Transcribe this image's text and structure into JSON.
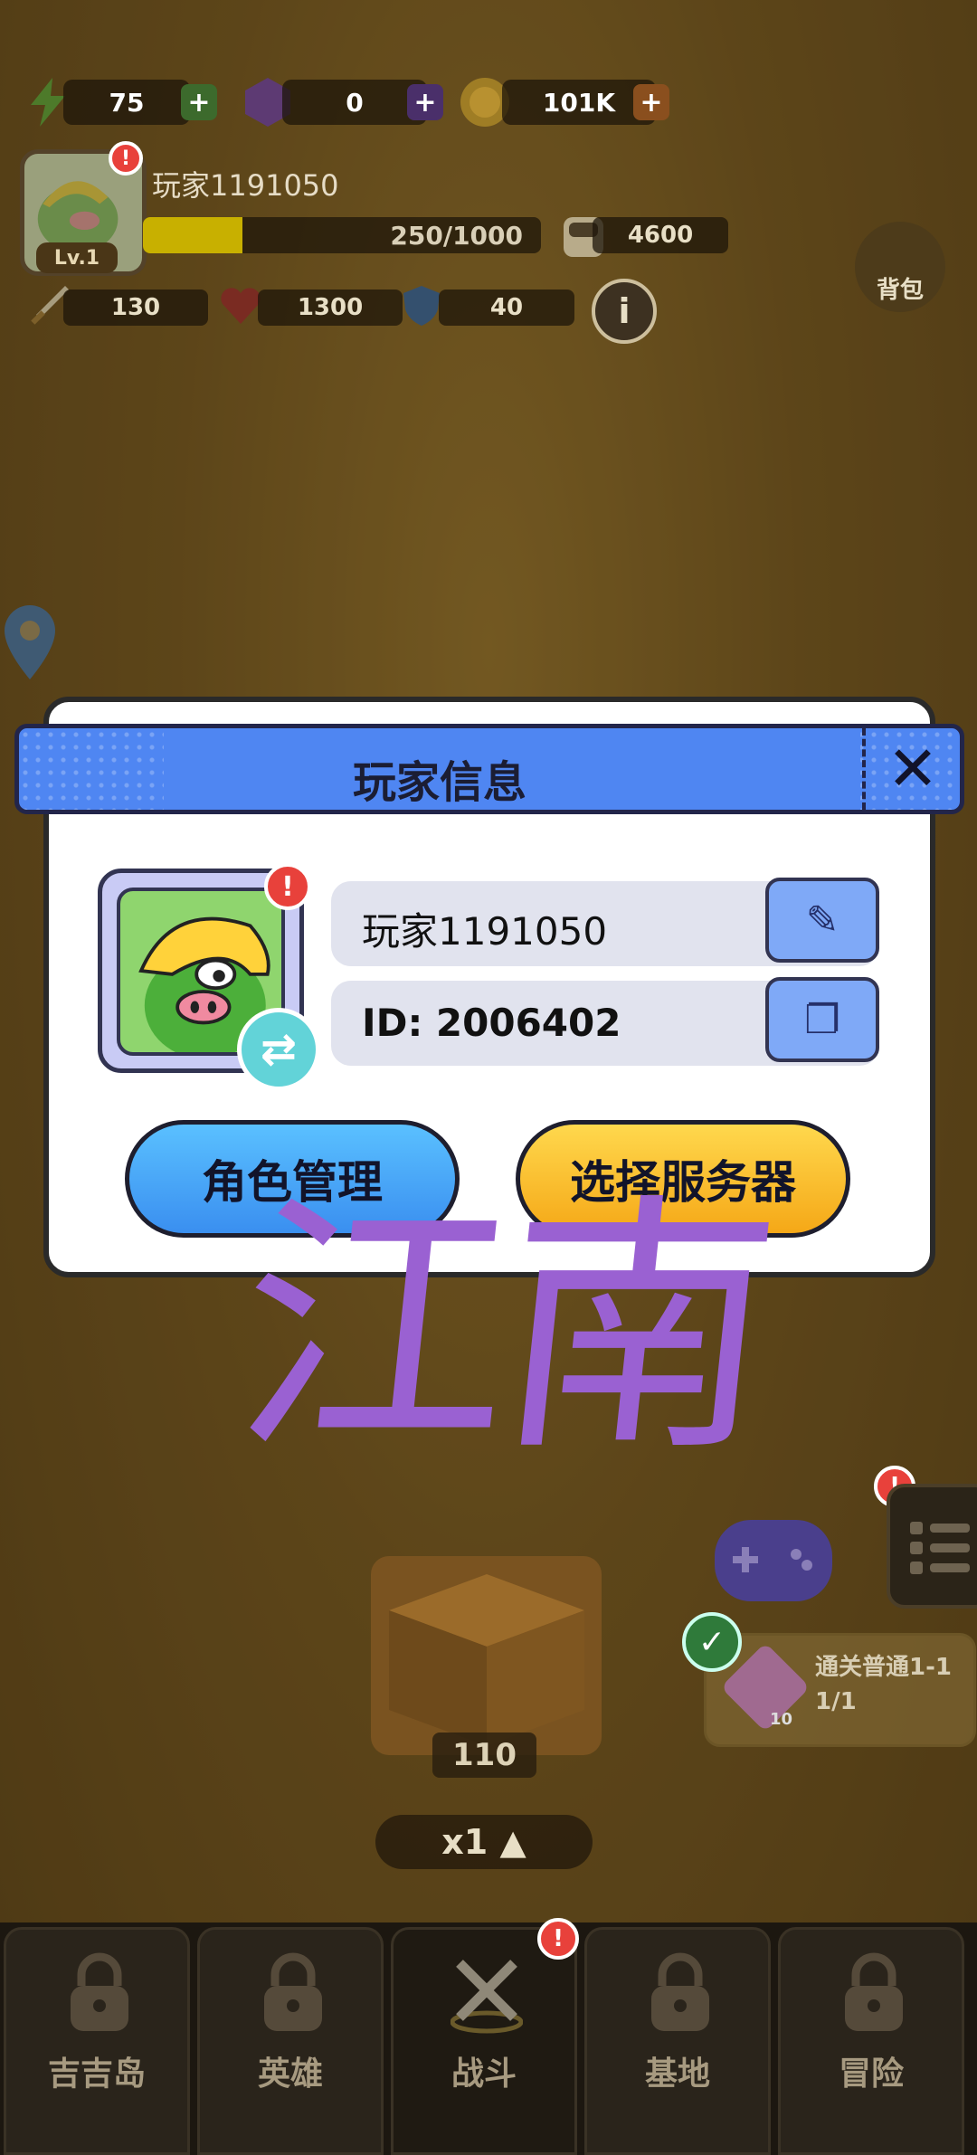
{
  "hud": {
    "energy": "75",
    "gems": "0",
    "coins": "101K",
    "player_name": "玩家1191050",
    "level": "Lv.1",
    "xp": "250/1000",
    "xp_fraction": 0.25,
    "power": "4600",
    "attack": "130",
    "hp": "1300",
    "defense": "40",
    "bag_label": "背包"
  },
  "dialog": {
    "title": "玩家信息",
    "name_value": "玩家1191050",
    "id_value": "ID: 2006402",
    "btn_role": "角色管理",
    "btn_server": "选择服务器",
    "badge": "!"
  },
  "watermark": "江南",
  "stage": {
    "task_title": "通关普通1-1",
    "task_progress": "1/1",
    "task_gem_count": "10",
    "chest_count": "110",
    "speed": "x1 ▲"
  },
  "nav": [
    {
      "label": "吉吉岛"
    },
    {
      "label": "英雄"
    },
    {
      "label": "战斗"
    },
    {
      "label": "基地"
    },
    {
      "label": "冒险"
    }
  ],
  "colors": {
    "dialog_header": "#4f86f2",
    "btn_blue": "#3a8ff0",
    "btn_yellow": "#f5a817",
    "watermark": "#9a61d2"
  }
}
